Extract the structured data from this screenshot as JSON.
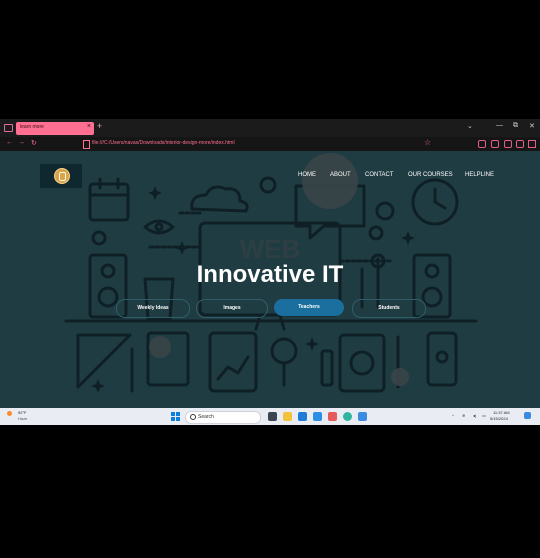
{
  "browser": {
    "tab_title": "learn more",
    "new_tab_symbol": "+",
    "close_symbol": "×",
    "address": "file:///C:/Users/navas/Downloads/interior-design-more/index.html",
    "window_controls": [
      "⌄",
      "—",
      "⧉",
      "✕"
    ],
    "nav": [
      "←",
      "→",
      "↻"
    ],
    "bookmark_symbol": "☆",
    "accent": "#ff6f91"
  },
  "site": {
    "menu": [
      "HOME",
      "ABOUT",
      "CONTACT",
      "OUR COURSES",
      "HELPLINE"
    ],
    "hero_title": "Innovative IT",
    "hero_background_word": "WEB",
    "buttons": [
      {
        "label": "Weekly Ideas",
        "active": false
      },
      {
        "label": "Images",
        "active": false
      },
      {
        "label": "Teachers",
        "active": true
      },
      {
        "label": "Students",
        "active": false
      }
    ],
    "colors": {
      "background": "#203c43",
      "active_button": "#1a6f9e",
      "illustration": "#0e2026"
    }
  },
  "taskbar": {
    "weather_temp": "92°F",
    "weather_desc": "Haze",
    "search_placeholder": "Search",
    "time": "11:37 AM",
    "date": "5/15/2024"
  }
}
